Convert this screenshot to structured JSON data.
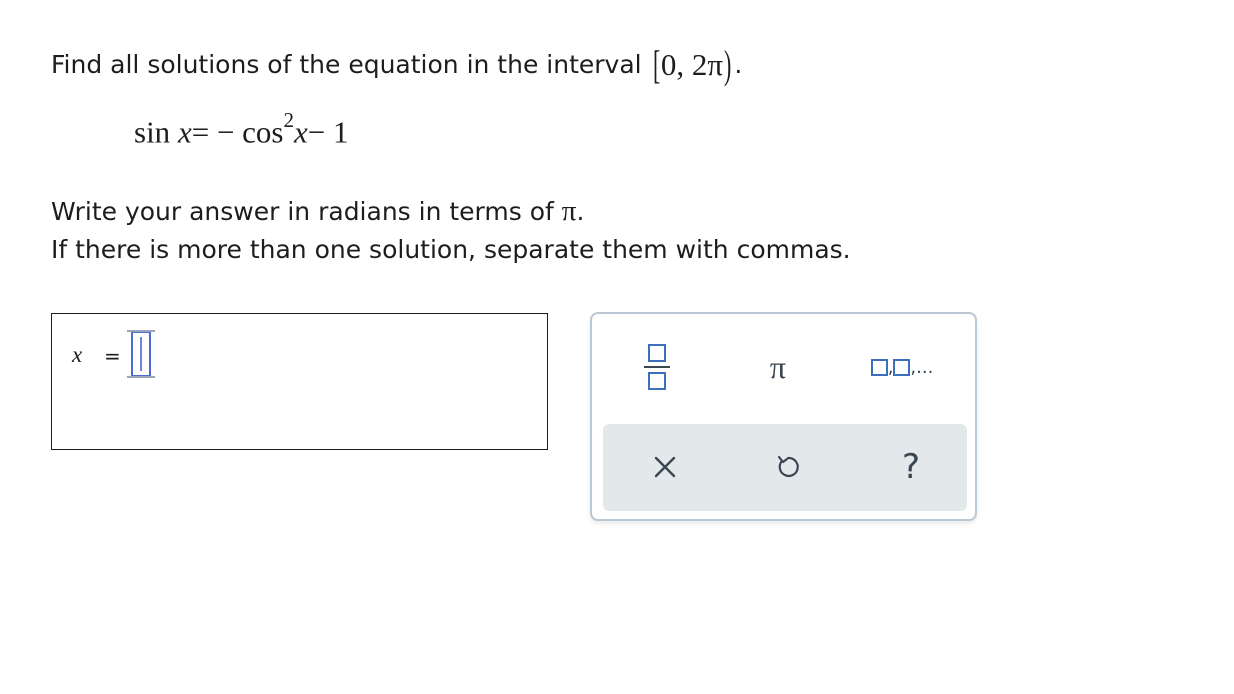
{
  "question": {
    "prompt_text": "Find all solutions of the equation in the interval",
    "interval_open": "[",
    "interval_body": "0, 2π",
    "interval_close": ")",
    "trailing_period": "."
  },
  "equation": {
    "lhs_fn": "sin",
    "lhs_var": "x",
    "equals": "=",
    "minus": "−",
    "rhs_fn": "cos",
    "exponent": "2",
    "rhs_var": "x",
    "tail": "− 1"
  },
  "instructions": {
    "line1_prefix": "Write your answer in radians in terms of",
    "line1_symbol": "π",
    "line1_suffix": ".",
    "line2": "If there is more than one solution, separate them with commas."
  },
  "answer": {
    "variable": "x",
    "equals": "=",
    "value": ""
  },
  "palette": {
    "pi_label": "π",
    "list_dots": ",...",
    "list_comma": ",",
    "help_label": "?"
  },
  "colors": {
    "accent_blue": "#3d6fbf",
    "input_border": "#4c6bd8",
    "palette_border": "#b9c8d4",
    "palette_bottom_bg": "#e3e8eb"
  },
  "icons": [
    "fraction-icon",
    "pi-icon",
    "list-icon",
    "clear-icon",
    "undo-icon",
    "help-icon"
  ]
}
